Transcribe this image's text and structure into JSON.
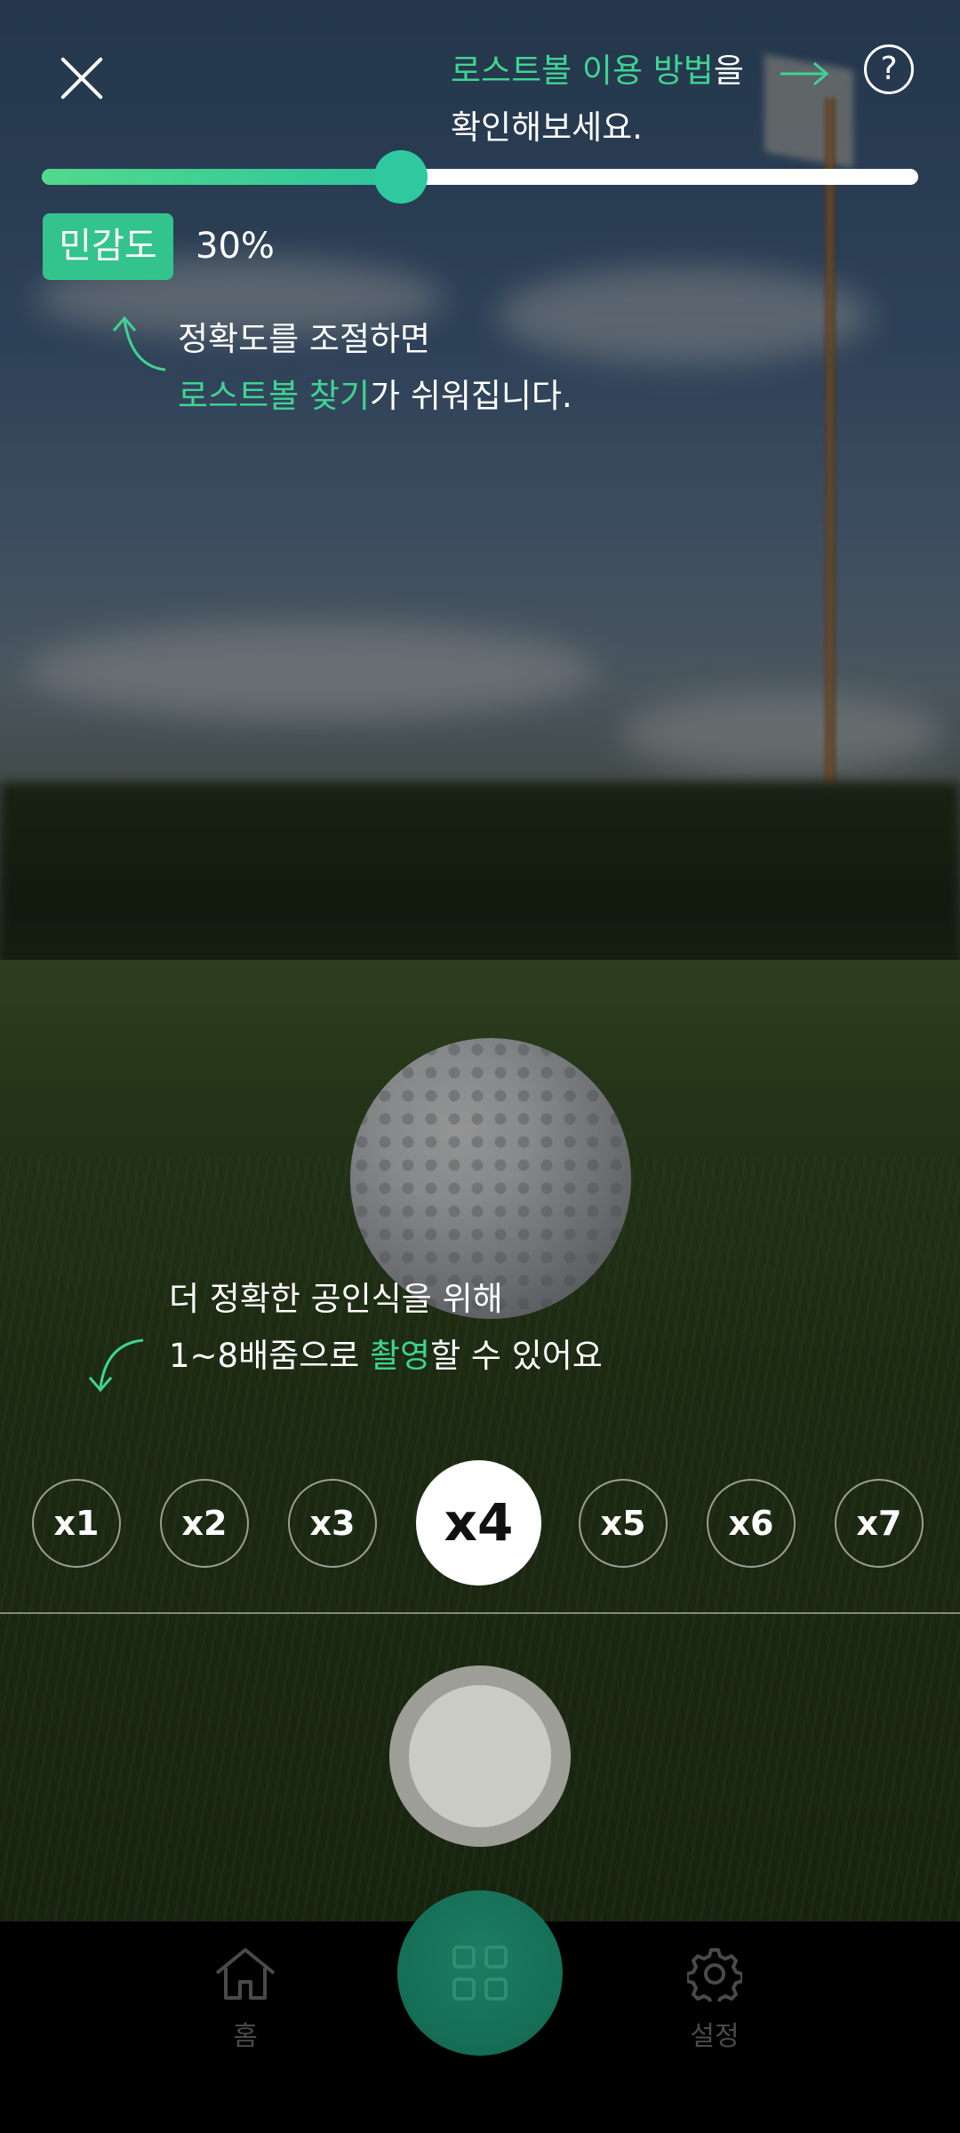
{
  "header": {
    "howto_highlight": "로스트볼 이용 방법",
    "howto_suffix": "을",
    "howto_line2": "확인해보세요.",
    "help_symbol": "?"
  },
  "sensitivity": {
    "label": "민감도",
    "value_text": "30%",
    "level": 0.41
  },
  "tips": {
    "accuracy_line1": "정확도를 조절하면",
    "accuracy_highlight": "로스트볼 찾기",
    "accuracy_suffix": "가 쉬워집니다.",
    "zoom_line1": "더 정확한 공인식을 위해",
    "zoom_prefix": "1~8배줌으로 ",
    "zoom_highlight": "촬영",
    "zoom_suffix": "할 수 있어요"
  },
  "zoom_levels": [
    "x1",
    "x2",
    "x3",
    "x4",
    "x5",
    "x6",
    "x7"
  ],
  "selected_zoom": "x4",
  "nav": {
    "home_label": "홈",
    "settings_label": "설정"
  },
  "icons": {
    "close": "close-icon",
    "help": "help-icon",
    "arrow": "arrow-right-icon",
    "home": "home-icon",
    "grid": "grid-icon",
    "settings": "gear-icon"
  },
  "colors": {
    "accent": "#3fd394",
    "badge": "#33c38d",
    "center_button": "#136650"
  }
}
